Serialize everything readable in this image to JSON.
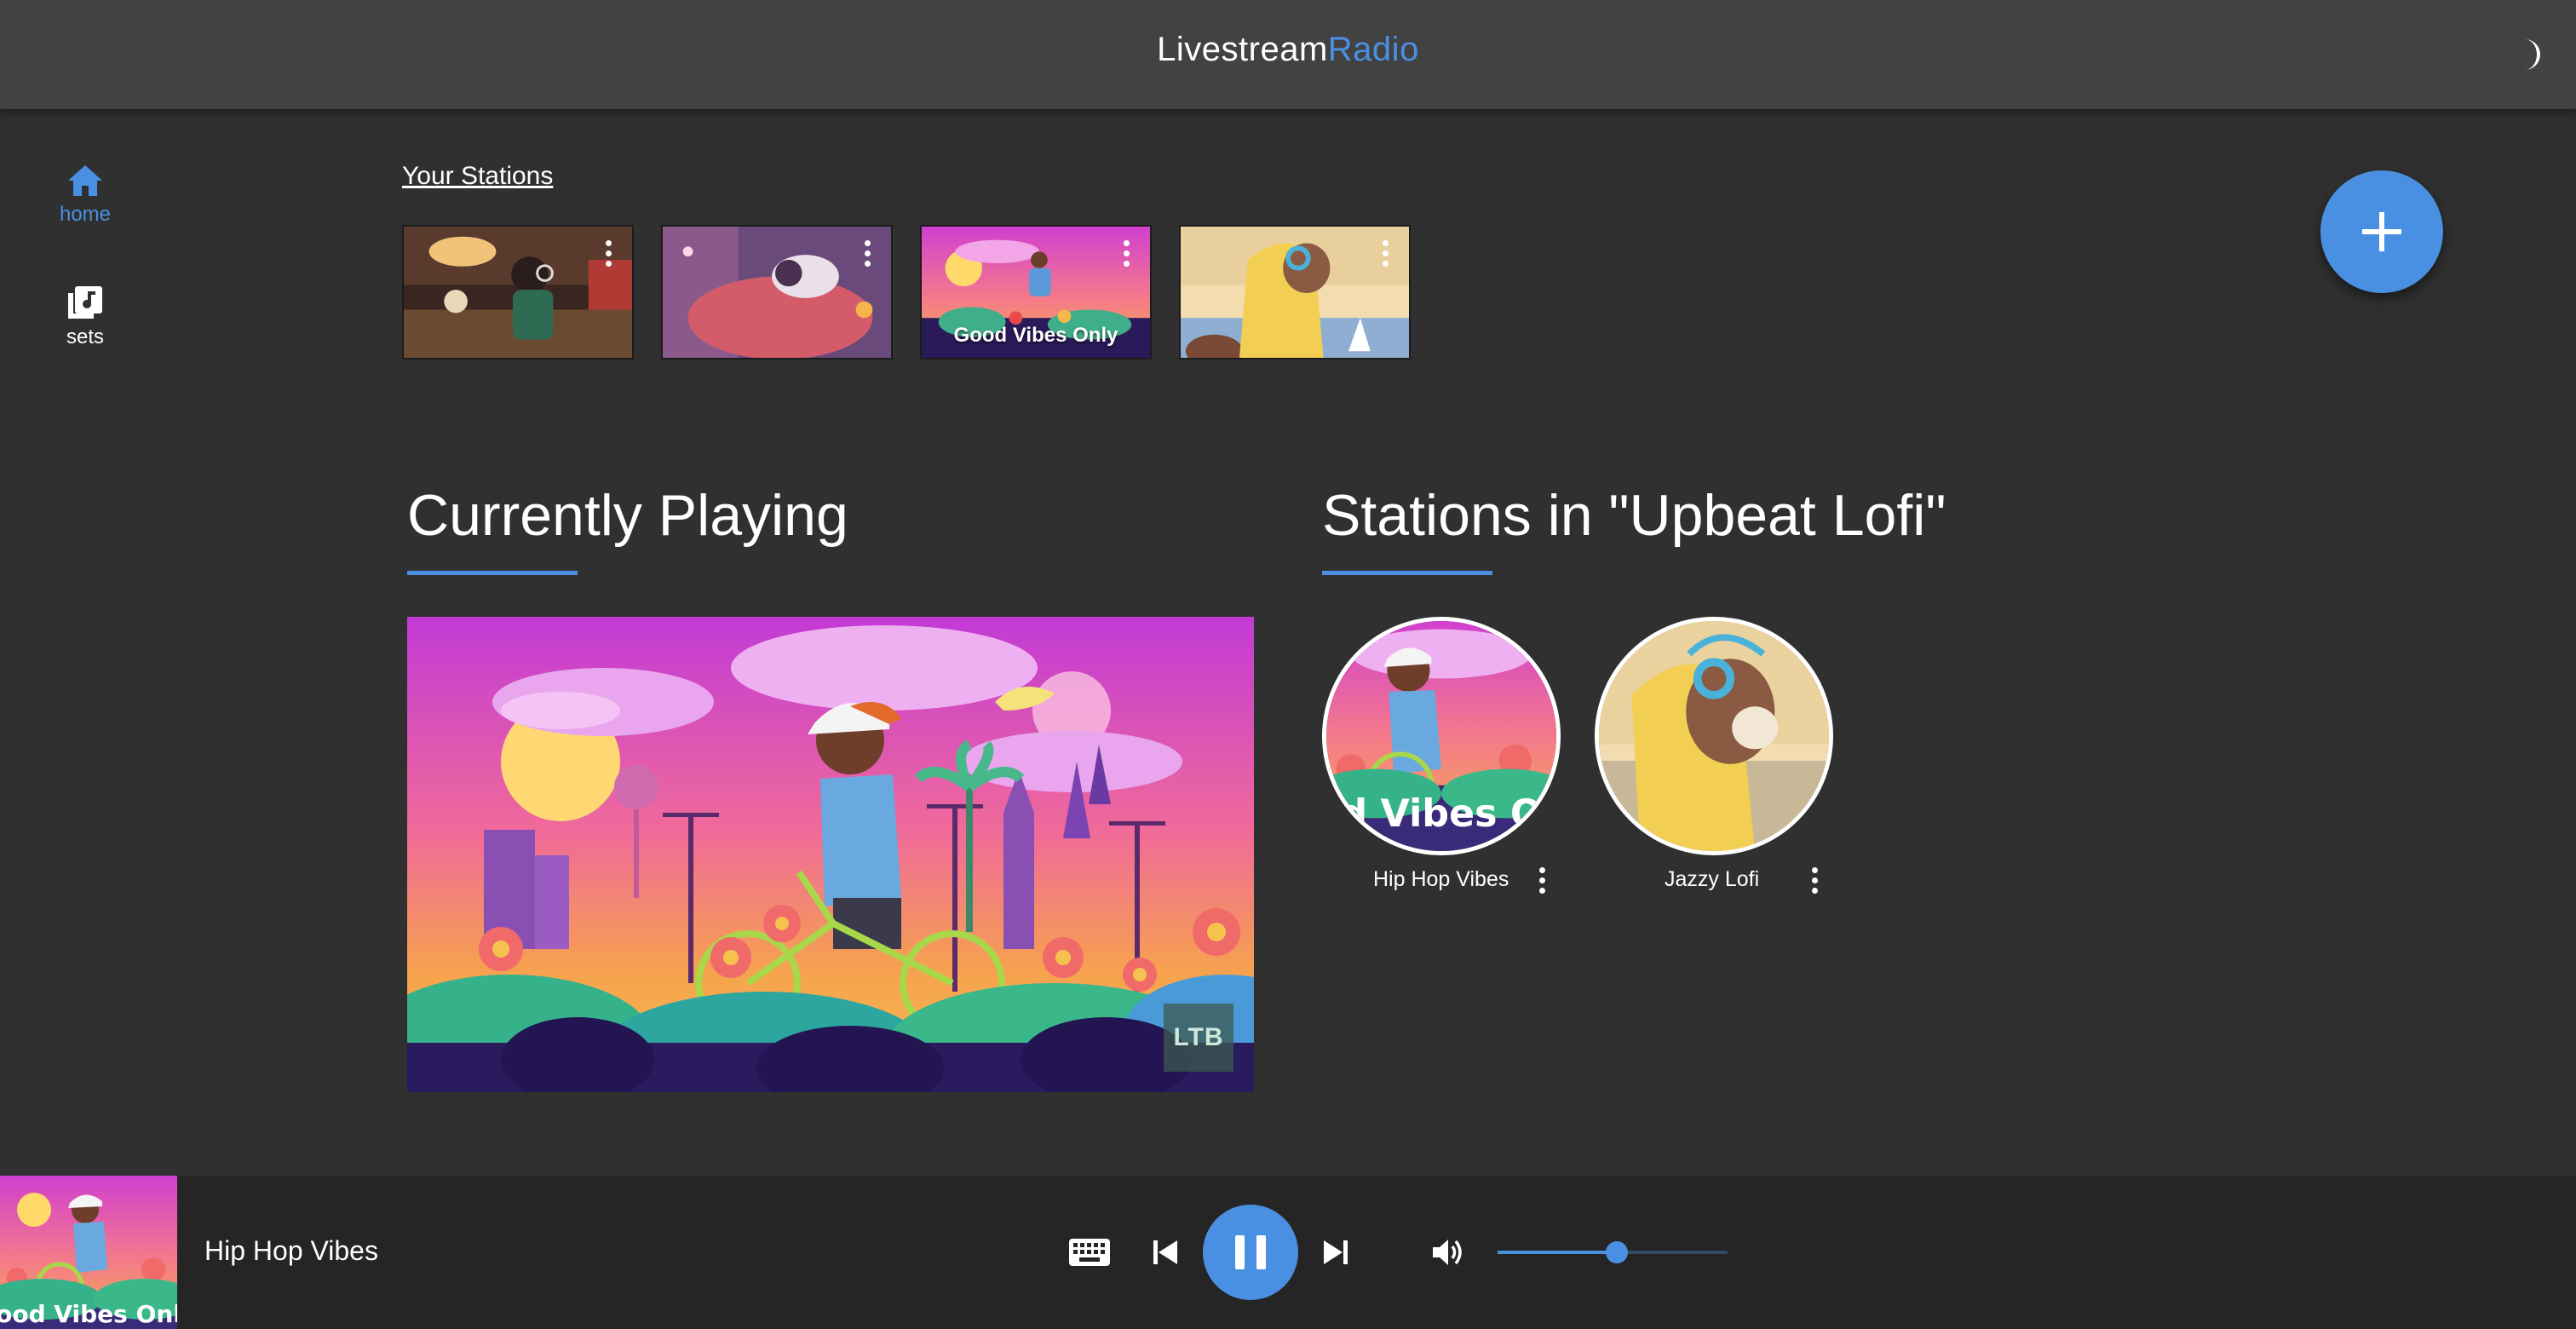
{
  "app": {
    "title_part1": "Livestream",
    "title_part2": "Radio",
    "theme_icon": "moon-icon"
  },
  "nav": {
    "items": [
      {
        "label": "home",
        "icon": "home-icon",
        "active": true
      },
      {
        "label": "sets",
        "icon": "library-music-icon",
        "active": false
      }
    ]
  },
  "your_stations": {
    "heading": "Your Stations",
    "thumbnails": [
      {
        "caption": "",
        "menu_icon": "more-vert-icon"
      },
      {
        "caption": "",
        "menu_icon": "more-vert-icon"
      },
      {
        "caption": "Good Vibes Only",
        "menu_icon": "more-vert-icon"
      },
      {
        "caption": "",
        "menu_icon": "more-vert-icon"
      }
    ]
  },
  "fab": {
    "icon": "add-icon"
  },
  "currently_playing": {
    "heading": "Currently Playing",
    "watermark": "LTB"
  },
  "set_stations": {
    "heading": "Stations in \"Upbeat Lofi\"",
    "stations": [
      {
        "name": "Hip Hop Vibes",
        "overlay_text": "d Vibes O"
      },
      {
        "name": "Jazzy Lofi",
        "overlay_text": ""
      }
    ]
  },
  "player": {
    "title": "Hip Hop Vibes",
    "thumb_text": "ood Vibes Onl",
    "controls": [
      "keyboard-icon",
      "skip-previous-icon",
      "pause-icon",
      "skip-next-icon",
      "volume-up-icon"
    ],
    "volume": 0.52
  },
  "colors": {
    "accent": "#4a90e2",
    "background": "#303030",
    "appbar": "#424242",
    "playerbar": "#252525"
  }
}
